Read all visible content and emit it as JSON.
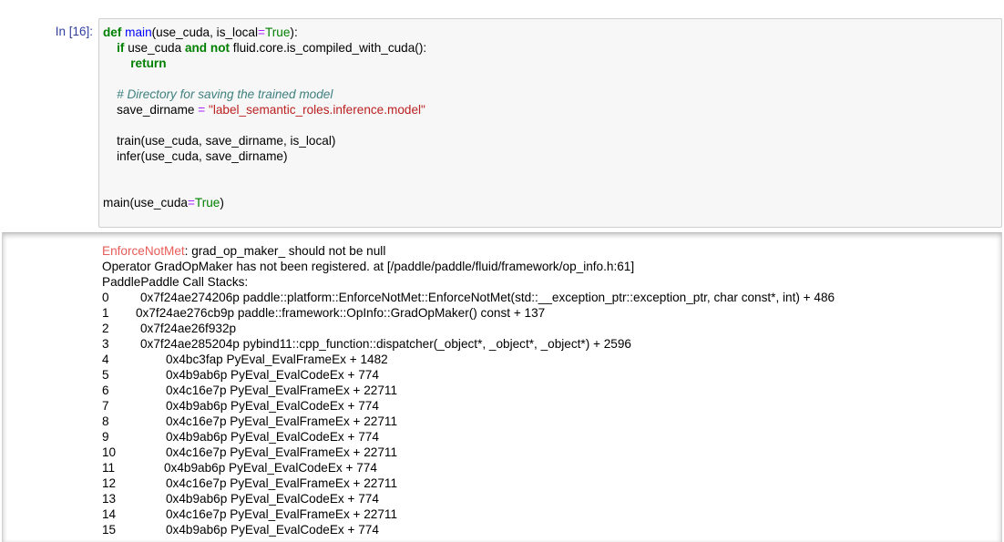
{
  "input_cell": {
    "prompt": "In [16]:",
    "code_lines": [
      [
        [
          "kw",
          "def"
        ],
        [
          "t",
          " "
        ],
        [
          "fn",
          "main"
        ],
        [
          "t",
          "(use_cuda, is_local"
        ],
        [
          "op",
          "="
        ],
        [
          "bi",
          "True"
        ],
        [
          "t",
          "):"
        ]
      ],
      [
        [
          "t",
          "    "
        ],
        [
          "kw",
          "if"
        ],
        [
          "t",
          " use_cuda "
        ],
        [
          "kw",
          "and"
        ],
        [
          "t",
          " "
        ],
        [
          "kw",
          "not"
        ],
        [
          "t",
          " fluid.core.is_compiled_with_cuda():"
        ]
      ],
      [
        [
          "t",
          "        "
        ],
        [
          "kw",
          "return"
        ]
      ],
      [
        [
          "t",
          ""
        ]
      ],
      [
        [
          "t",
          "    "
        ],
        [
          "cm",
          "# Directory for saving the trained model"
        ]
      ],
      [
        [
          "t",
          "    save_dirname "
        ],
        [
          "op",
          "="
        ],
        [
          "t",
          " "
        ],
        [
          "str",
          "\"label_semantic_roles.inference.model\""
        ]
      ],
      [
        [
          "t",
          ""
        ]
      ],
      [
        [
          "t",
          "    train(use_cuda, save_dirname, is_local)"
        ]
      ],
      [
        [
          "t",
          "    infer(use_cuda, save_dirname)"
        ]
      ],
      [
        [
          "t",
          ""
        ]
      ],
      [
        [
          "t",
          ""
        ]
      ],
      [
        [
          "t",
          "main(use_cuda"
        ],
        [
          "op",
          "="
        ],
        [
          "bi",
          "True"
        ],
        [
          "t",
          ")"
        ]
      ]
    ]
  },
  "output_cell": {
    "error_name": "EnforceNotMet",
    "error_message": ": grad_op_maker_ should not be null",
    "line2": "Operator GradOpMaker has not been registered. at [/paddle/paddle/fluid/framework/op_info.h:61]",
    "line3": "PaddlePaddle Call Stacks:",
    "frames": [
      {
        "num": "0",
        "text": "0x7f24ae274206p paddle::platform::EnforceNotMet::EnforceNotMet(std::__exception_ptr::exception_ptr, char const*, int) + 486",
        "lvl": 0
      },
      {
        "num": "1",
        "text": "0x7f24ae276cb9p paddle::framework::OpInfo::GradOpMaker() const + 137",
        "lvl": 1
      },
      {
        "num": "2",
        "text": "0x7f24ae26f932p",
        "lvl": 0
      },
      {
        "num": "3",
        "text": "0x7f24ae285204p pybind11::cpp_function::dispatcher(_object*, _object*, _object*) + 2596",
        "lvl": 0
      },
      {
        "num": "4",
        "text": "0x4bc3fap PyEval_EvalFrameEx + 1482",
        "lvl": 2
      },
      {
        "num": "5",
        "text": "0x4b9ab6p PyEval_EvalCodeEx + 774",
        "lvl": 2
      },
      {
        "num": "6",
        "text": "0x4c16e7p PyEval_EvalFrameEx + 22711",
        "lvl": 2
      },
      {
        "num": "7",
        "text": "0x4b9ab6p PyEval_EvalCodeEx + 774",
        "lvl": 2
      },
      {
        "num": "8",
        "text": "0x4c16e7p PyEval_EvalFrameEx + 22711",
        "lvl": 2
      },
      {
        "num": "9",
        "text": "0x4b9ab6p PyEval_EvalCodeEx + 774",
        "lvl": 2
      },
      {
        "num": "10",
        "text": "0x4c16e7p PyEval_EvalFrameEx + 22711",
        "lvl": 2
      },
      {
        "num": "11",
        "text": "0x4b9ab6p PyEval_EvalCodeEx + 774",
        "lvl": 3
      },
      {
        "num": "12",
        "text": "0x4c16e7p PyEval_EvalFrameEx + 22711",
        "lvl": 2
      },
      {
        "num": "13",
        "text": "0x4b9ab6p PyEval_EvalCodeEx + 774",
        "lvl": 2
      },
      {
        "num": "14",
        "text": "0x4c16e7p PyEval_EvalFrameEx + 22711",
        "lvl": 2
      },
      {
        "num": "15",
        "text": "0x4b9ab6p PyEval_EvalCodeEx + 774",
        "lvl": 2
      }
    ]
  }
}
